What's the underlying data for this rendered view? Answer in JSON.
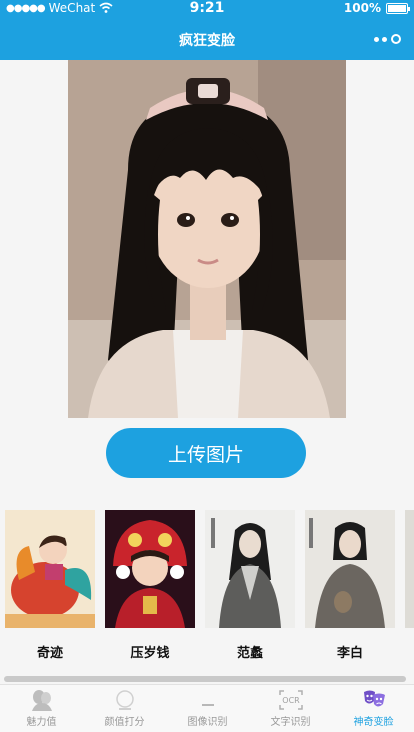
{
  "status_bar": {
    "carrier": "WeChat",
    "time": "9:21",
    "battery": "100%"
  },
  "nav": {
    "title": "疯狂变脸"
  },
  "upload_button": "上传图片",
  "templates": [
    {
      "label": "奇迹"
    },
    {
      "label": "压岁钱"
    },
    {
      "label": "范蠡"
    },
    {
      "label": "李白"
    }
  ],
  "tabbar": {
    "items": [
      {
        "label": "魅力值",
        "icon": "face-silhouette-icon"
      },
      {
        "label": "颜值打分",
        "icon": "score-face-icon"
      },
      {
        "label": "图像识别",
        "icon": "image-recognition-icon"
      },
      {
        "label": "文字识别",
        "icon": "ocr-icon"
      },
      {
        "label": "神奇变脸",
        "icon": "theater-masks-icon"
      }
    ],
    "active_index": 4
  },
  "colors": {
    "primary": "#1da1e0",
    "tab_inactive": "#999999"
  }
}
